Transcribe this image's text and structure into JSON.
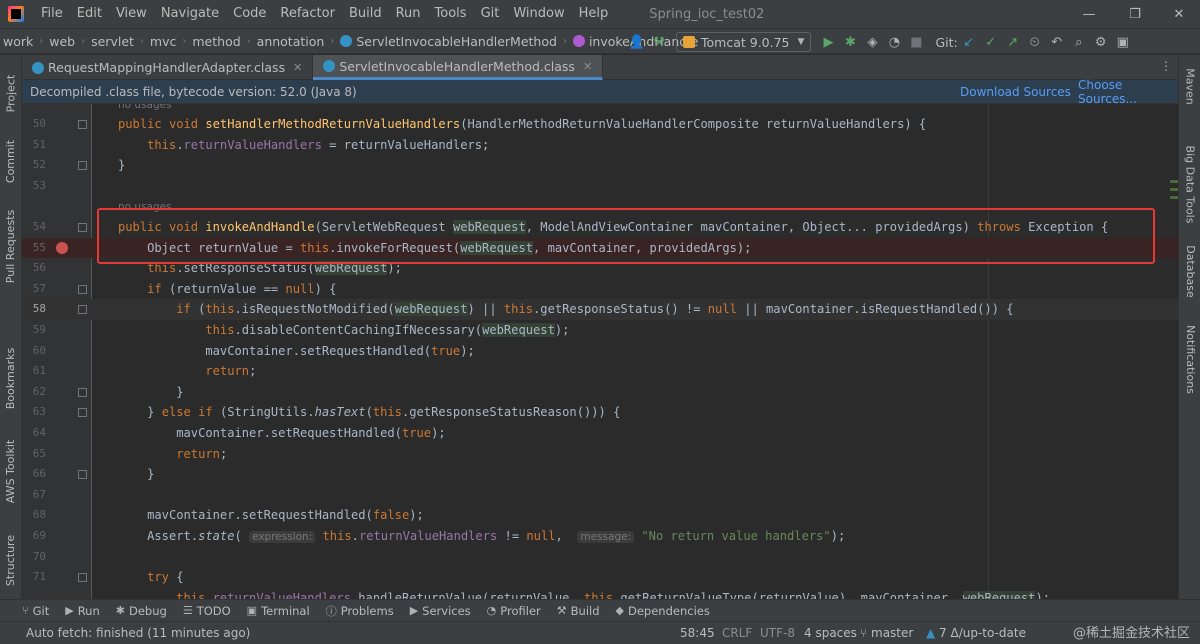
{
  "menubar": {
    "items": [
      "File",
      "Edit",
      "View",
      "Navigate",
      "Code",
      "Refactor",
      "Build",
      "Run",
      "Tools",
      "Git",
      "Window",
      "Help"
    ],
    "project_title": "Spring_ioc_test02",
    "minimize": "—",
    "maximize": "❐",
    "close": "✕"
  },
  "breadcrumb": [
    "work",
    "web",
    "servlet",
    "mvc",
    "method",
    "annotation",
    "ServletInvocableHandlerMethod",
    "invokeAndHandle"
  ],
  "toolbar": {
    "run_config": "Tomcat 9.0.75",
    "git_label": "Git:"
  },
  "left_stripe": [
    "Project",
    "Commit",
    "Pull Requests",
    "Bookmarks",
    "AWS Toolkit",
    "Structure"
  ],
  "right_stripe": [
    "Maven",
    "Big Data Tools",
    "Database",
    "Notifications"
  ],
  "tabs": [
    {
      "label": "RequestMappingHandlerAdapter.class",
      "active": false
    },
    {
      "label": "ServletInvocableHandlerMethod.class",
      "active": true
    }
  ],
  "banner": {
    "text": "Decompiled .class file, bytecode version: 52.0 (Java 8)",
    "download": "Download Sources",
    "choose": "Choose Sources..."
  },
  "editor": {
    "hint_no_usages": "no usages",
    "lines": {
      "l50": "50",
      "l51": "51",
      "l52": "52",
      "l53": "53",
      "l54": "54",
      "l55": "55",
      "l56": "56",
      "l57": "57",
      "l58": "58",
      "l59": "59",
      "l60": "60",
      "l61": "61",
      "l62": "62",
      "l63": "63",
      "l64": "64",
      "l65": "65",
      "l66": "66",
      "l67": "67",
      "l68": "68",
      "l69": "69",
      "l70": "70",
      "l71": "71"
    },
    "inlay_expression": "expression:",
    "inlay_message": "message:",
    "string_no_return": "\"No return value handlers\""
  },
  "bottom_tools": [
    {
      "icon": "git-icon",
      "label": "Git"
    },
    {
      "icon": "run-icon",
      "label": "Run"
    },
    {
      "icon": "debug-icon",
      "label": "Debug"
    },
    {
      "icon": "todo-icon",
      "label": "TODO"
    },
    {
      "icon": "terminal-icon",
      "label": "Terminal"
    },
    {
      "icon": "problems-icon",
      "label": "Problems"
    },
    {
      "icon": "services-icon",
      "label": "Services"
    },
    {
      "icon": "profiler-icon",
      "label": "Profiler"
    },
    {
      "icon": "build-icon",
      "label": "Build"
    },
    {
      "icon": "dependencies-icon",
      "label": "Dependencies"
    }
  ],
  "statusbar": {
    "message": "Auto fetch: finished (11 minutes ago)",
    "position": "58:45",
    "line_sep": "CRLF",
    "encoding": "UTF-8",
    "indent": "4 spaces",
    "branch": "master",
    "git_status": "7 Δ/up-to-date",
    "watermark": "@稀土掘金技术社区"
  },
  "colors": {
    "keyword": "#cc7832",
    "function": "#ffc66d",
    "field": "#9876aa",
    "string": "#6a8759",
    "highlight_box": "#e53935",
    "breakpoint": "#c75450"
  }
}
